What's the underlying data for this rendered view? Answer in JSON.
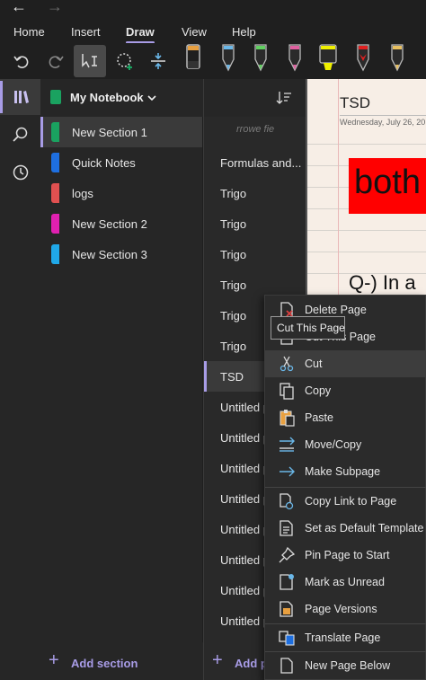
{
  "ribbon": {
    "tabs": [
      {
        "label": "Home"
      },
      {
        "label": "Insert"
      },
      {
        "label": "Draw",
        "active": true
      },
      {
        "label": "View"
      },
      {
        "label": "Help"
      }
    ],
    "tools": [
      {
        "icon": "undo-icon"
      },
      {
        "icon": "redo-icon"
      },
      {
        "icon": "type-select-icon",
        "selected": true
      },
      {
        "icon": "lasso-select-icon"
      },
      {
        "icon": "add-space-icon"
      }
    ],
    "pens": [
      {
        "icon": "pen-icon",
        "color": "#e8a040"
      },
      {
        "icon": "pen-icon",
        "color": "#6ab7e8"
      },
      {
        "icon": "pen-icon",
        "color": "#60d060"
      },
      {
        "icon": "pen-icon",
        "color": "#e060a0"
      },
      {
        "icon": "highlighter-icon",
        "color": "#f0f000"
      },
      {
        "icon": "pen-icon",
        "color": "#e02020"
      },
      {
        "icon": "pen-icon",
        "color": "#e8c060"
      }
    ]
  },
  "rail": [
    {
      "icon": "notebooks-icon",
      "active": true
    },
    {
      "icon": "search-icon"
    },
    {
      "icon": "recent-icon"
    }
  ],
  "notebook": {
    "name": "My Notebook",
    "color": "#1aa260"
  },
  "sections": [
    {
      "label": "New Section 1",
      "color": "#1aa260",
      "active": true
    },
    {
      "label": "Quick Notes",
      "color": "#1e6fe0"
    },
    {
      "label": "logs",
      "color": "#e05050"
    },
    {
      "label": "New Section 2",
      "color": "#e020b0"
    },
    {
      "label": "New Section 3",
      "color": "#20a8e8"
    }
  ],
  "add_section_label": "Add section",
  "pages": [
    {
      "label": "Formulas and..."
    },
    {
      "label": "Trigo"
    },
    {
      "label": "Trigo"
    },
    {
      "label": "Trigo"
    },
    {
      "label": "Trigo"
    },
    {
      "label": "Trigo"
    },
    {
      "label": "Trigo"
    },
    {
      "label": "TSD",
      "active": true
    },
    {
      "label": "Untitled page"
    },
    {
      "label": "Untitled page"
    },
    {
      "label": "Untitled page"
    },
    {
      "label": "Untitled page"
    },
    {
      "label": "Untitled page"
    },
    {
      "label": "Untitled page"
    },
    {
      "label": "Untitled page"
    },
    {
      "label": "Untitled page"
    }
  ],
  "add_page_label": "Add page",
  "canvas": {
    "title": "TSD",
    "date": "Wednesday, July 26, 20",
    "highlight_text": "both",
    "question_text": "Q-) In a"
  },
  "context_menu": {
    "items": [
      {
        "label": "Delete Page",
        "icon": "delete-page-icon"
      },
      {
        "label": "Cut This Page",
        "icon": "cut-page-icon"
      },
      {
        "label": "Cut",
        "icon": "scissors-icon",
        "hover": true
      },
      {
        "label": "Copy",
        "icon": "copy-icon"
      },
      {
        "label": "Paste",
        "icon": "paste-icon"
      },
      {
        "label": "Move/Copy",
        "icon": "move-copy-icon"
      },
      {
        "label": "Make Subpage",
        "icon": "subpage-arrow-icon"
      },
      {
        "label": "Copy Link to Page",
        "icon": "copy-link-icon"
      },
      {
        "label": "Set as Default Template",
        "icon": "template-icon"
      },
      {
        "label": "Pin Page to Start",
        "icon": "pin-icon"
      },
      {
        "label": "Mark as Unread",
        "icon": "unread-icon"
      },
      {
        "label": "Page Versions",
        "icon": "versions-icon"
      },
      {
        "label": "Translate Page",
        "icon": "translate-icon"
      },
      {
        "label": "New Page Below",
        "icon": "new-page-icon"
      }
    ]
  },
  "tooltip": {
    "text": "Cut This Page"
  },
  "accent_color": "#a89ce6"
}
